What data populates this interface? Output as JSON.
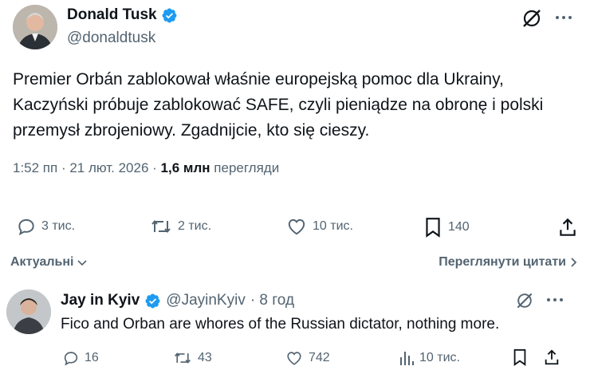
{
  "tweet": {
    "author_name": "Donald Tusk",
    "author_handle": "@donaldtusk",
    "text": "Premier Orbán zablokował właśnie europejską pomoc dla Ukrainy, Kaczyński próbuje zablokować SAFE, czyli pieniądze na obronę i polski przemysł zbrojeniowy. Zgadnijcie, kto się cieszy.",
    "time": "1:52 пп · 21 лют. 2026 ·",
    "views_count": "1,6 млн",
    "views_label": "перегляди",
    "replies": "3 тис.",
    "reposts": "2 тис.",
    "likes": "10 тис.",
    "bookmarks": "140"
  },
  "sort": {
    "left_label": "Актуальні",
    "right_label": "Переглянути цитати"
  },
  "reply": {
    "author_name": "Jay in Kyiv",
    "author_handle": "@JayinKyiv",
    "age": "· 8 год",
    "text": "Fico and Orban are whores of the Russian dictator, nothing more.",
    "replies": "16",
    "reposts": "43",
    "likes": "742",
    "views": "10 тис."
  },
  "colors": {
    "verified": "#1d9bf0",
    "text_secondary": "#536471",
    "text_primary": "#0f1419"
  },
  "icons": [
    "grok-icon",
    "more-icon",
    "reply-icon",
    "repost-icon",
    "like-icon",
    "bookmark-icon",
    "share-icon",
    "views-icon",
    "verified-icon",
    "chevron-down-icon",
    "chevron-right-icon"
  ]
}
